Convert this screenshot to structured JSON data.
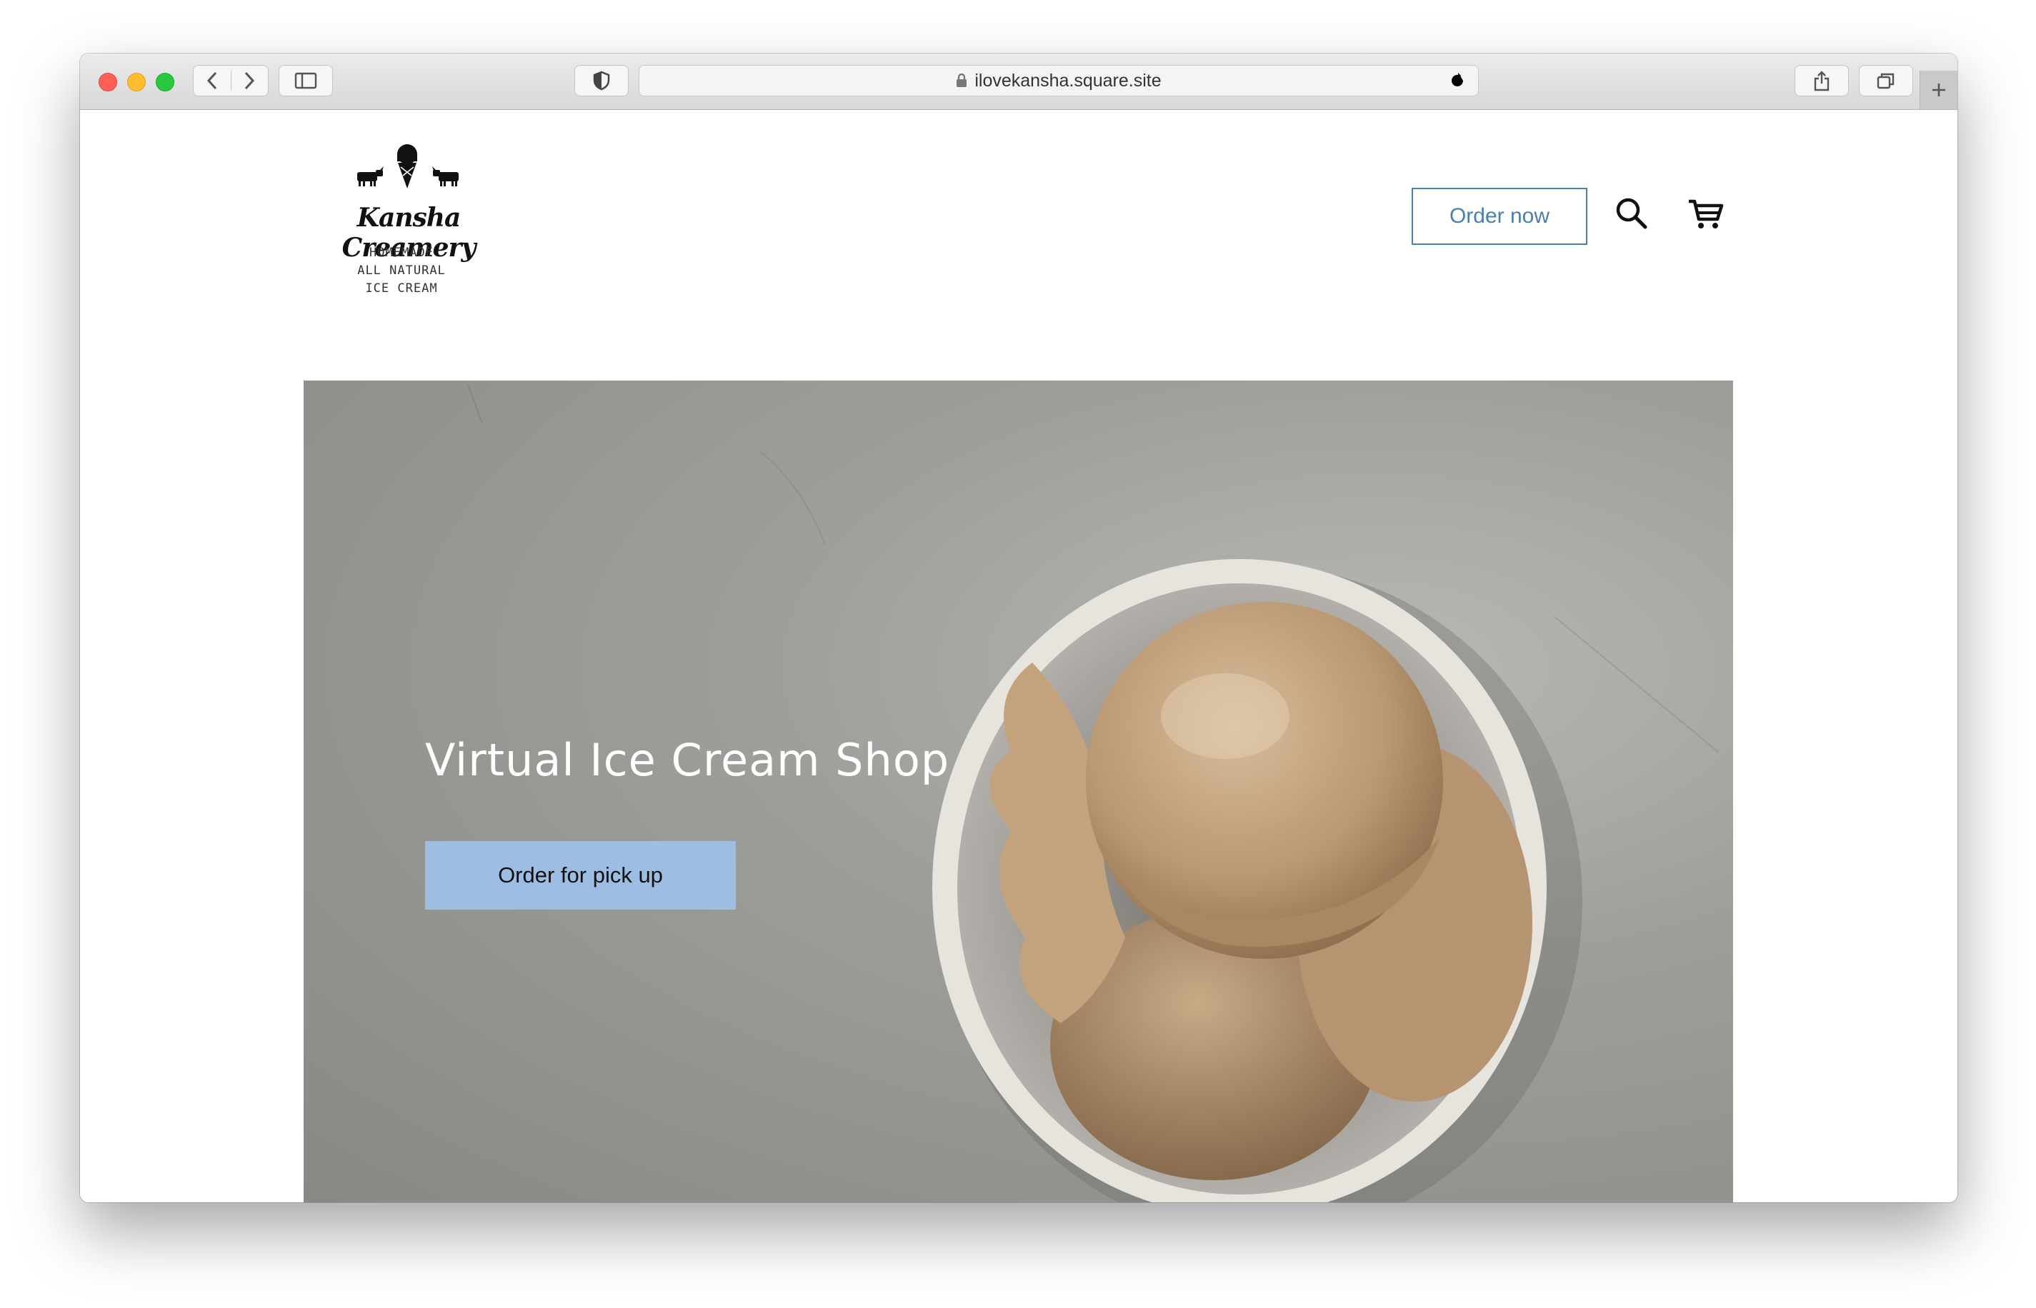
{
  "browser": {
    "url": "ilovekansha.square.site"
  },
  "header": {
    "logo_name": "Kansha Creamery",
    "logo_tagline": [
      "HOMEMADE",
      "ALL NATURAL",
      "ICE CREAM"
    ],
    "order_now_label": "Order now"
  },
  "hero": {
    "title": "Virtual Ice Cream Shop",
    "cta_label": "Order for pick up"
  },
  "colors": {
    "accent": "#4a7fb5",
    "cta_background": "#9dbde3"
  },
  "icons": [
    "back-icon",
    "forward-icon",
    "sidebar-icon",
    "shield-icon",
    "lock-icon",
    "reload-icon",
    "share-icon",
    "tabs-icon",
    "plus-icon",
    "search-icon",
    "cart-icon"
  ]
}
